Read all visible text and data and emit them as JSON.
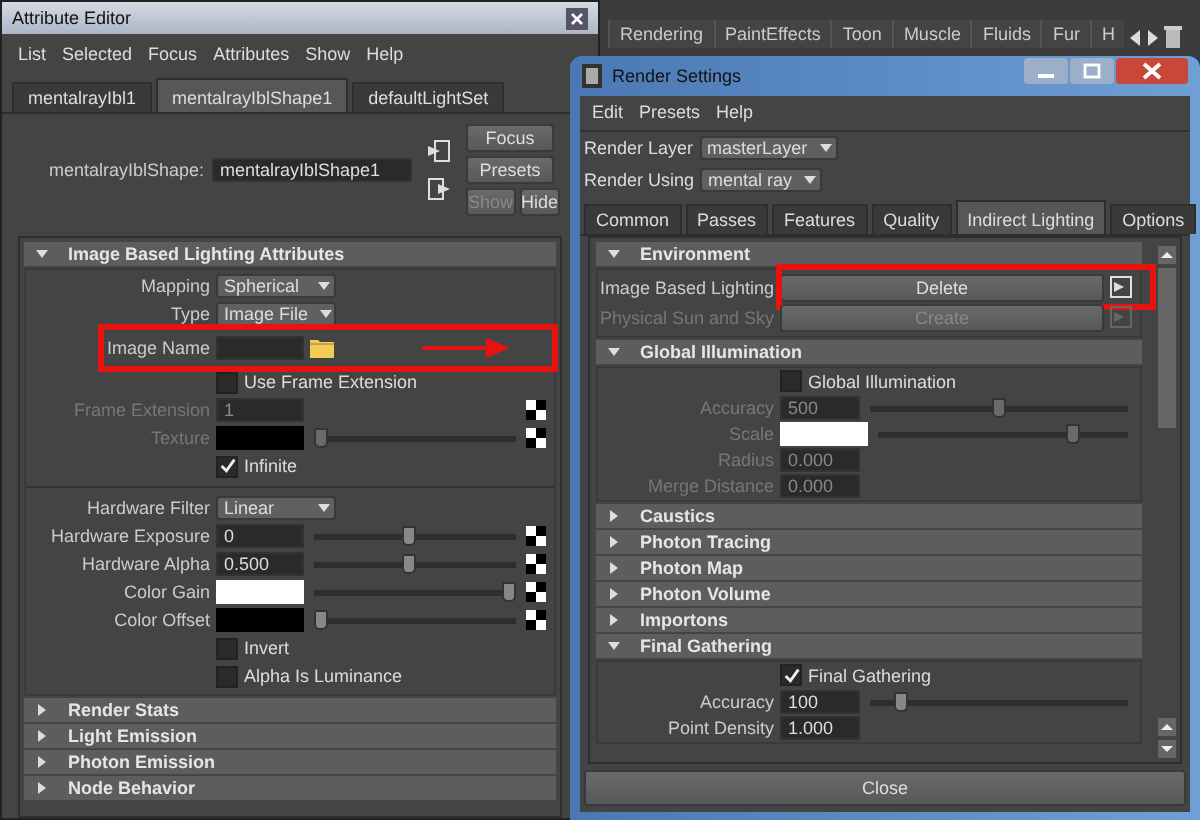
{
  "shelf_tabs": [
    "Rendering",
    "PaintEffects",
    "Toon",
    "Muscle",
    "Fluids",
    "Fur",
    "H"
  ],
  "attribute_editor": {
    "title": "Attribute Editor",
    "menu": [
      "List",
      "Selected",
      "Focus",
      "Attributes",
      "Show",
      "Help"
    ],
    "tabs": [
      {
        "label": "mentalrayIbl1",
        "selected": false
      },
      {
        "label": "mentalrayIblShape1",
        "selected": true
      },
      {
        "label": "defaultLightSet",
        "selected": false
      }
    ],
    "node": {
      "label": "mentalrayIblShape:",
      "value": "mentalrayIblShape1"
    },
    "side_buttons": [
      {
        "label": "Focus",
        "disabled": false
      },
      {
        "label": "Presets",
        "disabled": false
      }
    ],
    "small_buttons": [
      {
        "label": "Show",
        "disabled": true
      },
      {
        "label": "Hide",
        "disabled": false
      }
    ],
    "sections": [
      {
        "title": "Image Based Lighting Attributes",
        "expanded": true,
        "rows": [
          {
            "kind": "dropdown",
            "label": "Mapping",
            "value": "Spherical",
            "disabled": false
          },
          {
            "kind": "dropdown",
            "label": "Type",
            "value": "Image File",
            "disabled": false
          },
          {
            "kind": "file",
            "label": "Image Name",
            "disabled": false
          },
          {
            "kind": "checkbox",
            "label": "Use Frame Extension",
            "checked": false,
            "disabled": false
          },
          {
            "kind": "field",
            "label": "Frame Extension",
            "value": "1",
            "disabled": true,
            "map": true
          },
          {
            "kind": "color",
            "label": "Texture",
            "color": "#000000",
            "level": 0,
            "disabled": true,
            "map": true
          },
          {
            "kind": "checkbox",
            "label": "Infinite",
            "checked": true,
            "disabled": false
          },
          {
            "kind": "separator"
          },
          {
            "kind": "dropdown",
            "label": "Hardware Filter",
            "value": "Linear",
            "disabled": false
          },
          {
            "kind": "field",
            "label": "Hardware Exposure",
            "value": "0",
            "level": 0.47,
            "disabled": false,
            "map": true
          },
          {
            "kind": "field",
            "label": "Hardware Alpha",
            "value": "0.500",
            "level": 0.47,
            "disabled": false,
            "map": true
          },
          {
            "kind": "color",
            "label": "Color Gain",
            "color": "#ffffff",
            "level": 1,
            "disabled": false,
            "map": true
          },
          {
            "kind": "color",
            "label": "Color Offset",
            "color": "#000000",
            "level": 0,
            "disabled": false,
            "map": true
          },
          {
            "kind": "checkbox",
            "label": "Invert",
            "checked": false,
            "disabled": false
          },
          {
            "kind": "checkbox",
            "label": "Alpha Is Luminance",
            "checked": false,
            "disabled": false
          }
        ]
      },
      {
        "title": "Render Stats",
        "expanded": false
      },
      {
        "title": "Light Emission",
        "expanded": false
      },
      {
        "title": "Photon Emission",
        "expanded": false
      },
      {
        "title": "Node Behavior",
        "expanded": false
      }
    ]
  },
  "render_settings": {
    "title": "Render Settings",
    "menu": [
      "Edit",
      "Presets",
      "Help"
    ],
    "selectors": [
      {
        "label": "Render Layer",
        "value": "masterLayer"
      },
      {
        "label": "Render Using",
        "value": "mental ray"
      }
    ],
    "tabs": [
      {
        "label": "Common",
        "selected": false
      },
      {
        "label": "Passes",
        "selected": false
      },
      {
        "label": "Features",
        "selected": false
      },
      {
        "label": "Quality",
        "selected": false
      },
      {
        "label": "Indirect Lighting",
        "selected": true
      },
      {
        "label": "Options",
        "selected": false
      }
    ],
    "sections": [
      {
        "title": "Environment",
        "expanded": true,
        "rows": [
          {
            "kind": "button",
            "label": "Image Based Lighting",
            "value": "Delete",
            "disabled": false
          },
          {
            "kind": "button",
            "label": "Physical Sun and Sky",
            "value": "Create",
            "disabled": true
          }
        ]
      },
      {
        "title": "Global Illumination",
        "expanded": true,
        "rows": [
          {
            "kind": "checkbox",
            "label": "Global Illumination",
            "checked": false,
            "disabled": false
          },
          {
            "kind": "field",
            "label": "Accuracy",
            "value": "500",
            "level": 0.5,
            "disabled": true,
            "map": false
          },
          {
            "kind": "color",
            "label": "Scale",
            "color": "#ffffff",
            "level": 0.8,
            "disabled": true,
            "map": false
          },
          {
            "kind": "field",
            "label": "Radius",
            "value": "0.000",
            "disabled": true,
            "map": false
          },
          {
            "kind": "field",
            "label": "Merge Distance",
            "value": "0.000",
            "disabled": true,
            "map": false
          }
        ]
      },
      {
        "title": "Caustics",
        "expanded": false
      },
      {
        "title": "Photon Tracing",
        "expanded": false
      },
      {
        "title": "Photon Map",
        "expanded": false
      },
      {
        "title": "Photon Volume",
        "expanded": false
      },
      {
        "title": "Importons",
        "expanded": false
      },
      {
        "title": "Final Gathering",
        "expanded": true,
        "rows": [
          {
            "kind": "checkbox",
            "label": "Final Gathering",
            "checked": true,
            "disabled": false
          },
          {
            "kind": "field",
            "label": "Accuracy",
            "value": "100",
            "level": 0.1,
            "disabled": false,
            "map": false
          },
          {
            "kind": "field",
            "label": "Point Density",
            "value": "1.000",
            "disabled": false,
            "map": false
          }
        ]
      }
    ],
    "close_button": "Close"
  }
}
